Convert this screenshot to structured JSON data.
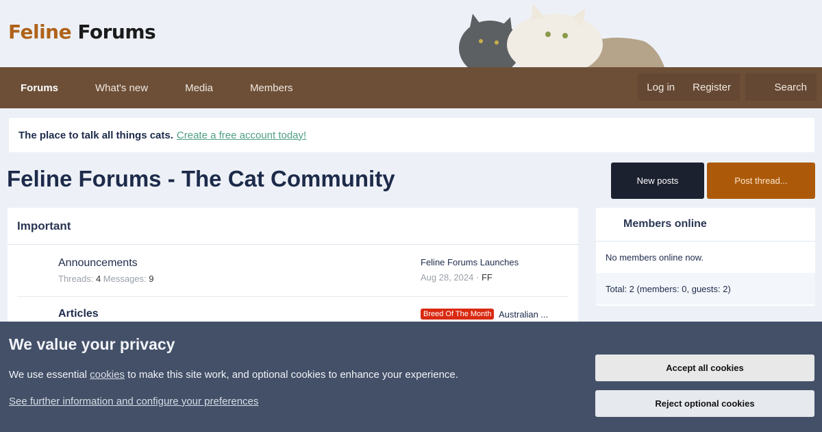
{
  "logo": {
    "part1": "Feline",
    "part2": "Forums"
  },
  "nav": {
    "items": [
      {
        "label": "Forums",
        "active": true
      },
      {
        "label": "What's new"
      },
      {
        "label": "Media"
      },
      {
        "label": "Members"
      }
    ],
    "login": "Log in",
    "register": "Register",
    "search": "Search"
  },
  "notice": {
    "text": "The place to talk all things cats.",
    "link": "Create a free account today!"
  },
  "page": {
    "title": "Feline Forums - The Cat Community",
    "new_posts": "New posts",
    "post_thread": "Post thread..."
  },
  "category": {
    "title": "Important",
    "nodes": [
      {
        "title": "Announcements",
        "threads_label": "Threads:",
        "threads": "4",
        "messages_label": "Messages:",
        "messages": "9",
        "latest_title": "Feline Forums Launches",
        "latest_date": "Aug 28, 2024",
        "latest_sep": "·",
        "latest_user": "FF"
      },
      {
        "title": "Articles",
        "badge": "Breed Of The Month",
        "latest_title": "Australian ..."
      }
    ]
  },
  "sidebar": {
    "title": "Members online",
    "none": "No members online now.",
    "total": "Total: 2 (members: 0, guests: 2)"
  },
  "cookie": {
    "title": "We value your privacy",
    "text_before": "We use essential",
    "text_link": "cookies",
    "text_after": "to make this site work, and optional cookies to enhance your experience.",
    "more_link": "See further information and configure your preferences",
    "accept": "Accept all cookies",
    "reject": "Reject optional cookies"
  },
  "colors": {
    "nav_bg": "#6d4f37",
    "accent": "#ac5a0a",
    "cookie_bg": "#435068",
    "badge": "#d92a12"
  }
}
